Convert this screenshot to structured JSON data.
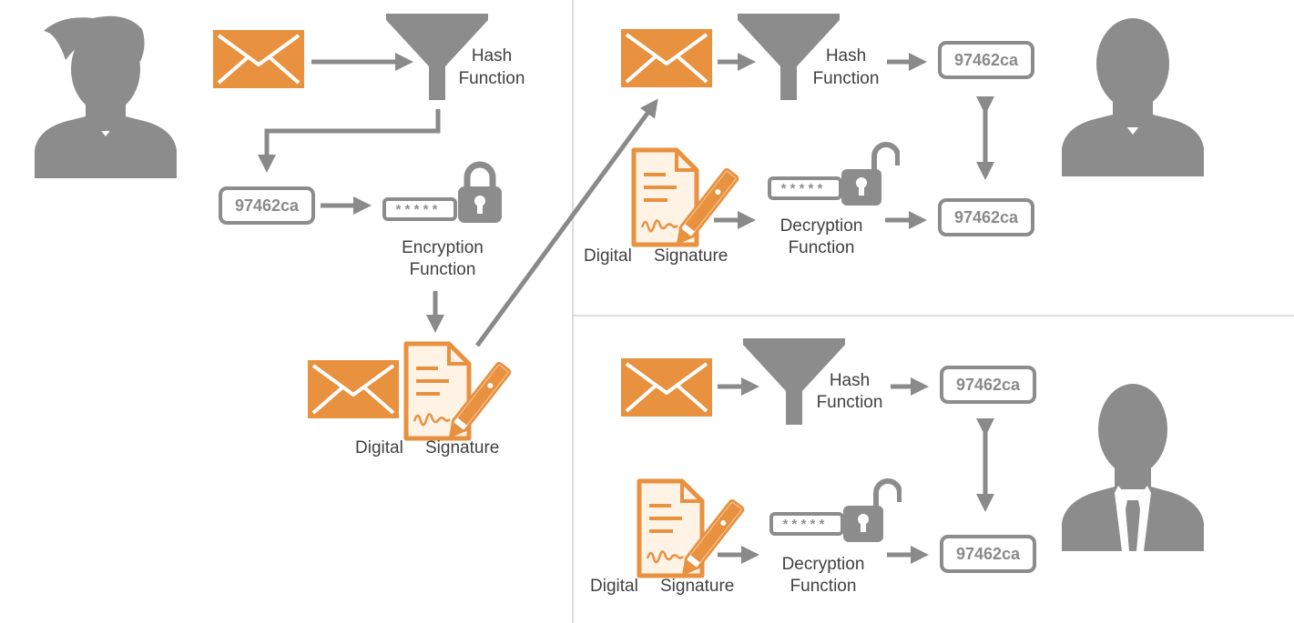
{
  "labels": {
    "hash_function_line1": "Hash",
    "hash_function_line2": "Function",
    "encryption_function_line1": "Encryption",
    "encryption_function_line2": "Function",
    "decryption_function_line1": "Decryption",
    "decryption_function_line2": "Function",
    "digital_signature_word1": "Digital",
    "digital_signature_word2": "Signature"
  },
  "hash_value": "97462ca",
  "password_mask": "*****",
  "colors": {
    "envelope": "#e8913f",
    "icon_gray": "#8c8c8c",
    "arrow": "#8a8a8a",
    "text": "#404040",
    "divider": "#dcdcdc"
  },
  "icons": {
    "sender": "person-silhouette-icon",
    "receiver_top": "person-silhouette-icon",
    "receiver_bottom": "businessman-silhouette-icon",
    "message": "envelope-icon",
    "hash": "funnel-icon",
    "lock": "padlock-icon",
    "signature": "signed-document-icon"
  }
}
